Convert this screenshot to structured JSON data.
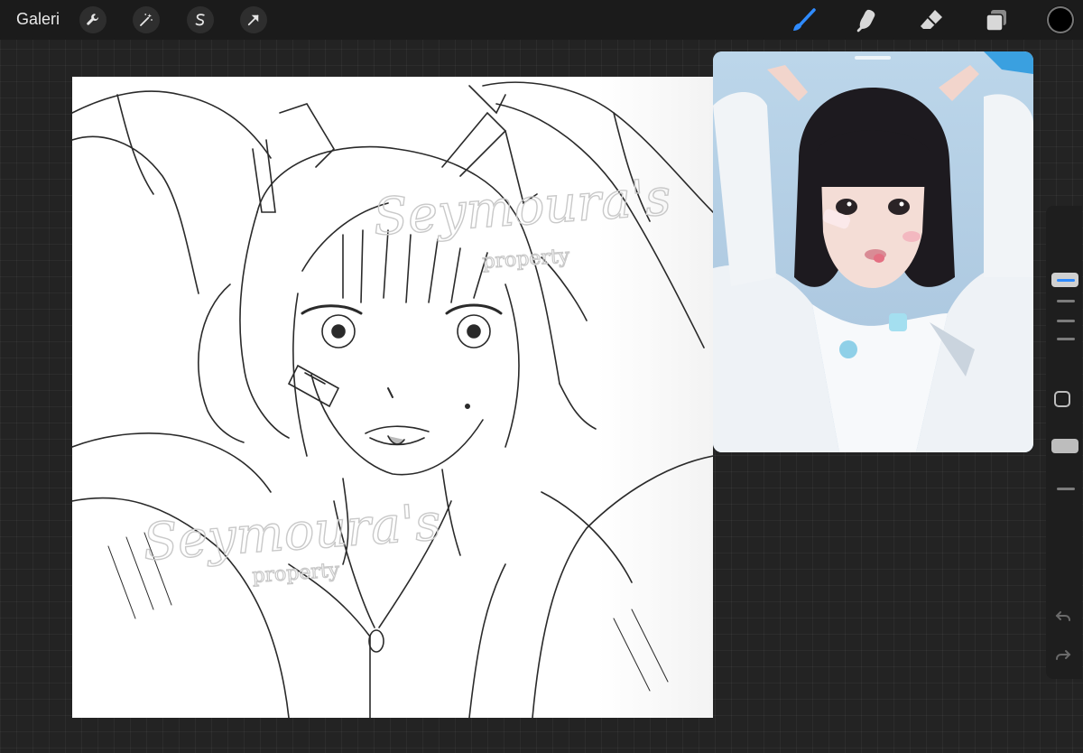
{
  "topbar": {
    "gallery_label": "Galeri",
    "left_tools": [
      {
        "name": "actions-wrench-icon"
      },
      {
        "name": "adjustments-wand-icon"
      },
      {
        "name": "selection-s-icon"
      },
      {
        "name": "transform-arrow-icon"
      }
    ],
    "right_tools": [
      {
        "name": "brush-icon",
        "active": true
      },
      {
        "name": "smudge-icon",
        "active": false
      },
      {
        "name": "eraser-icon",
        "active": false
      },
      {
        "name": "layers-icon",
        "active": false
      }
    ],
    "current_color": "#000000",
    "accent_color": "#2f8bff"
  },
  "canvas": {
    "watermark": {
      "line1": "Seymoura's",
      "line2": "property"
    }
  },
  "reference_window": {
    "shows": "reference photo"
  },
  "sidebar": {
    "brush_size_level": 0.5,
    "brush_opacity_level": 1.0,
    "undo_icon": "undo-arrow-icon",
    "redo_icon": "redo-arrow-icon"
  }
}
